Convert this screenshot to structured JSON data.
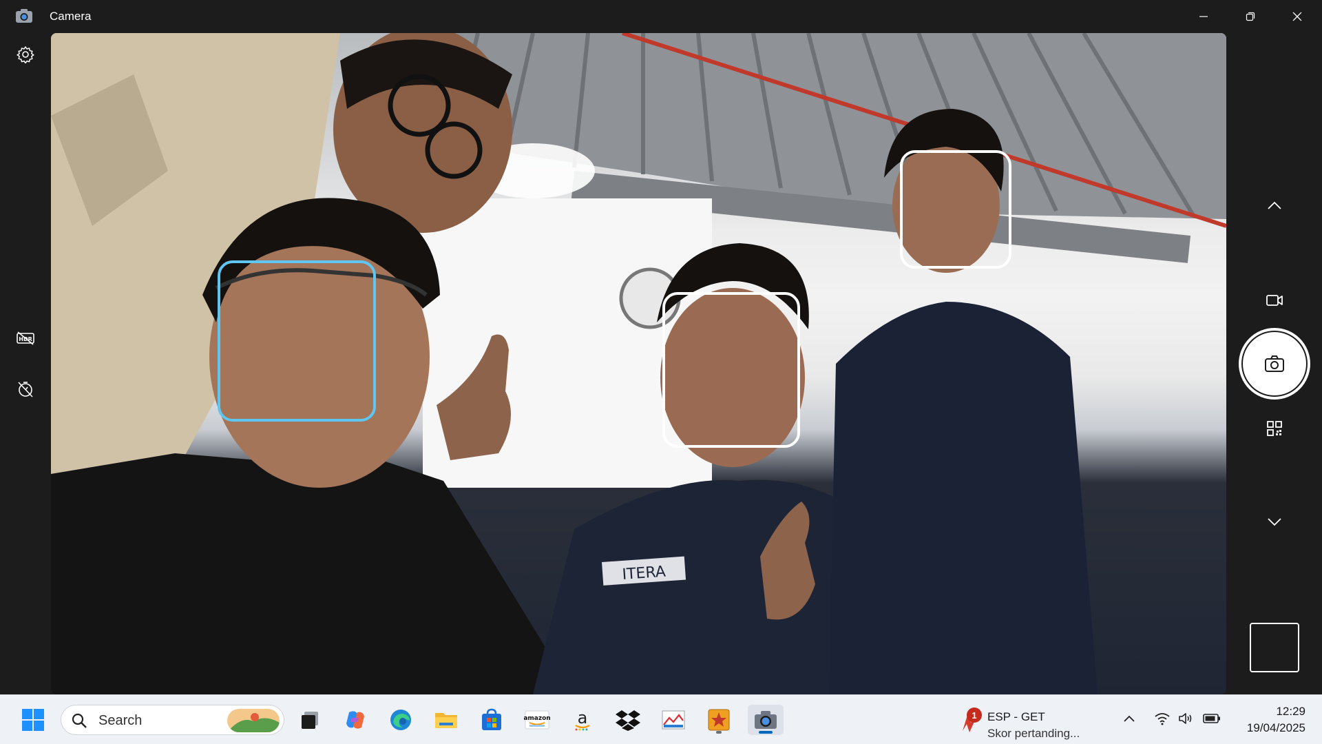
{
  "window": {
    "title": "Camera",
    "controls": [
      "minimize",
      "restore",
      "close"
    ]
  },
  "left_rail": {
    "items": [
      {
        "icon": "gear-icon",
        "name": "settings"
      },
      {
        "icon": "hdr-off-icon",
        "name": "hdr-toggle"
      },
      {
        "icon": "timer-off-icon",
        "name": "timer"
      }
    ]
  },
  "viewfinder": {
    "face_count": 4,
    "primary_face_color": "#5fc6f2",
    "secondary_face_color": "#ffffff"
  },
  "right_rail": {
    "items": [
      {
        "icon": "chevron-up-icon",
        "name": "mode-up"
      },
      {
        "icon": "video-icon",
        "name": "video-mode"
      },
      {
        "icon": "camera-icon",
        "name": "shutter"
      },
      {
        "icon": "qr-code-icon",
        "name": "barcode-mode"
      },
      {
        "icon": "chevron-down-icon",
        "name": "mode-down"
      },
      {
        "icon": "thumbnail",
        "name": "last-photo"
      }
    ]
  },
  "taskbar": {
    "search_placeholder": "Search",
    "apps": [
      {
        "name": "start",
        "icon": "windows-logo-icon"
      },
      {
        "name": "task-view",
        "icon": "task-view-icon"
      },
      {
        "name": "copilot",
        "icon": "copilot-icon"
      },
      {
        "name": "edge",
        "icon": "edge-icon"
      },
      {
        "name": "file-explorer",
        "icon": "folder-icon"
      },
      {
        "name": "microsoft-store",
        "icon": "store-icon"
      },
      {
        "name": "amazon-shopping",
        "icon": "amazon-icon",
        "label": "amazon"
      },
      {
        "name": "amazon-appstore",
        "icon": "amazon-a-icon"
      },
      {
        "name": "dropbox",
        "icon": "dropbox-icon"
      },
      {
        "name": "paint",
        "icon": "paint-icon"
      },
      {
        "name": "pinned-app",
        "icon": "star-app-icon"
      },
      {
        "name": "camera",
        "icon": "camera-icon",
        "active": true
      }
    ],
    "news": {
      "badge": "1",
      "title": "ESP - GET",
      "subtitle": "Skor pertanding..."
    },
    "tray": {
      "icons": [
        "chevron-up-icon",
        "wifi-icon",
        "volume-icon",
        "battery-icon"
      ]
    },
    "clock": {
      "time": "12:29",
      "date": "19/04/2025"
    },
    "accent": "#0067c0"
  }
}
